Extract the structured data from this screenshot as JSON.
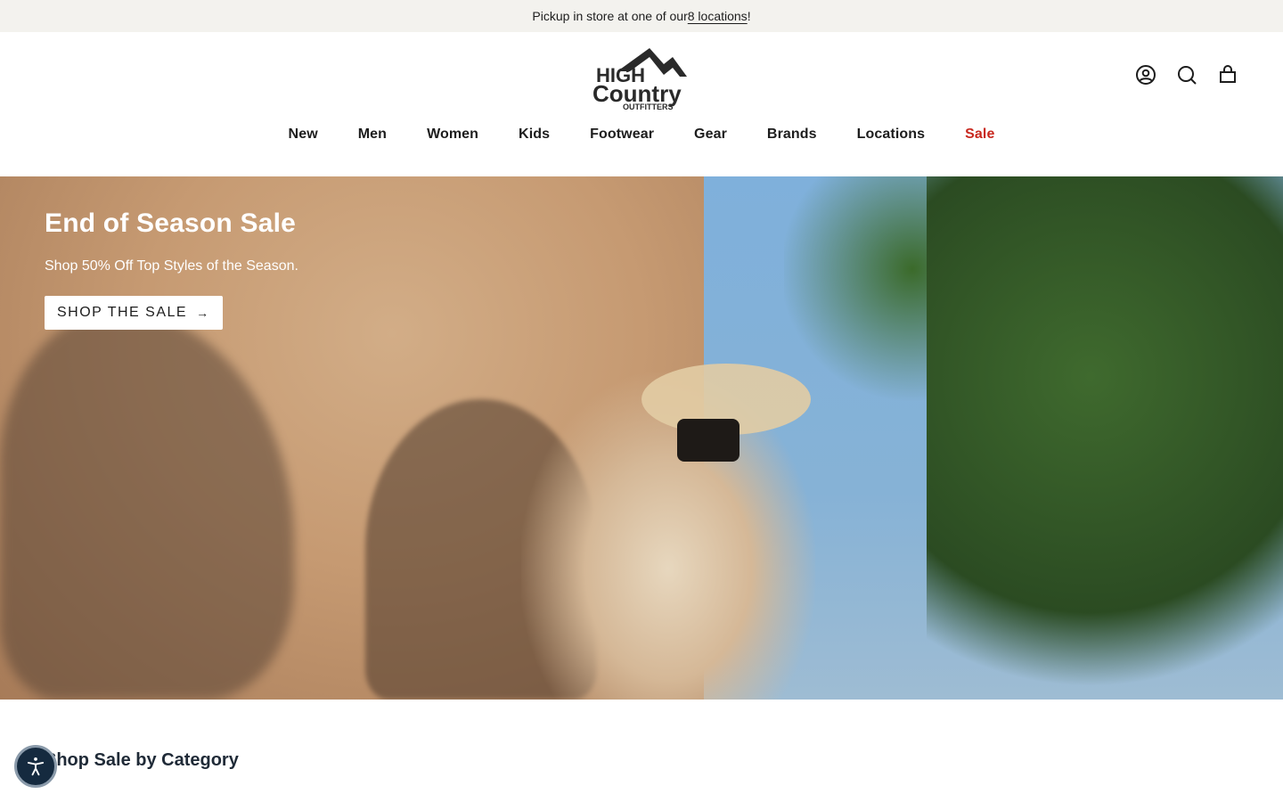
{
  "announcement": {
    "text_before": "Pickup in store at one of our ",
    "link": "8 locations",
    "text_after": "!"
  },
  "header": {
    "logo_text": [
      "HIGH",
      "Country",
      "OUTFITTERS"
    ],
    "icons": [
      "account-icon",
      "search-icon",
      "cart-icon"
    ]
  },
  "nav": {
    "items": [
      "New",
      "Men",
      "Women",
      "Kids",
      "Footwear",
      "Gear",
      "Brands",
      "Locations",
      "Sale"
    ],
    "sale_color": "#c8281e"
  },
  "hero": {
    "title": "End of Season Sale",
    "subtitle": "Shop 50% Off Top Styles of the Season.",
    "button_label": "SHOP THE SALE",
    "button_arrow": "→"
  },
  "section": {
    "title": "Shop Sale by Category"
  },
  "colors": {
    "announcement_bg": "#f3f2ee",
    "text": "#1d1d1d",
    "accessibility_bg": "#152a3f"
  }
}
